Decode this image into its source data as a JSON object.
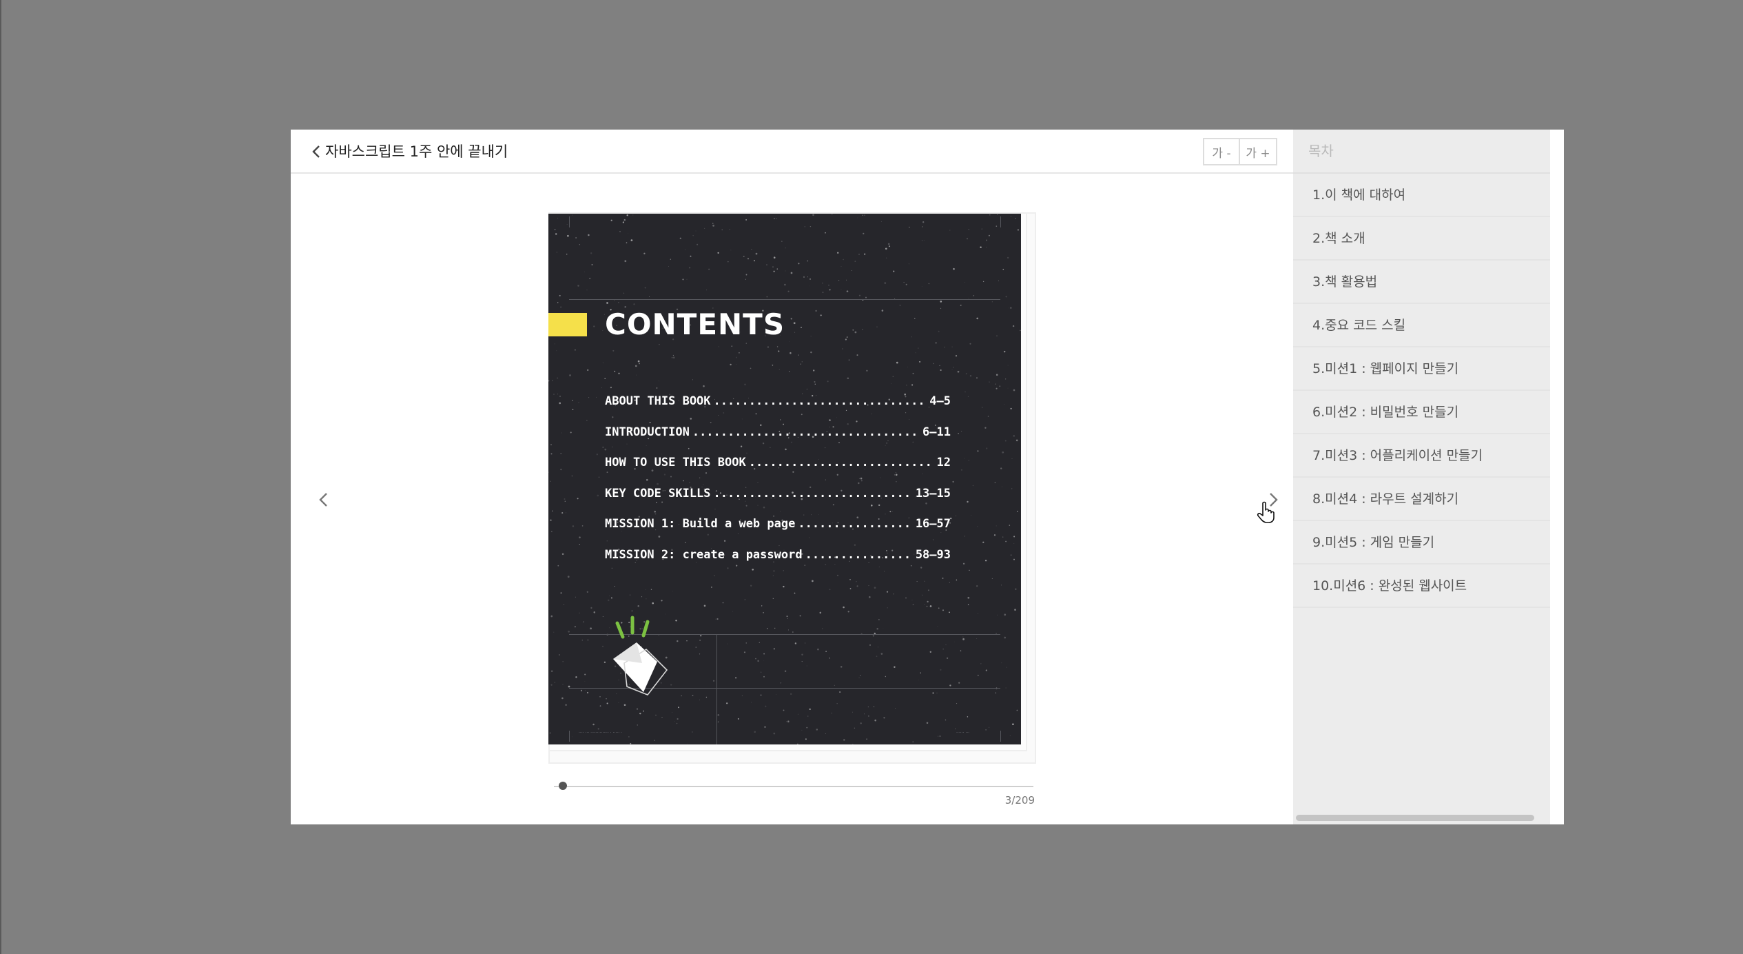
{
  "reader": {
    "title": "자바스크립트 1주 안에 끝내기",
    "font_decrease_label": "가 -",
    "font_increase_label": "가 +",
    "page_indicator": "3/209",
    "current_page": 3,
    "total_pages": 209
  },
  "book_page": {
    "heading": "CONTENTS",
    "entries": [
      {
        "label": "ABOUT THIS BOOK",
        "pages": "4–5"
      },
      {
        "label": "INTRODUCTION",
        "pages": "6–11"
      },
      {
        "label": "HOW TO USE THIS BOOK",
        "pages": "12"
      },
      {
        "label": "KEY CODE SKILLS",
        "pages": "13–15"
      },
      {
        "label": "MISSION 1: Build a web page",
        "pages": "16–57"
      },
      {
        "label": "MISSION 2: create a password",
        "pages": "58–93"
      }
    ],
    "accent_color": "#f5e04a",
    "background_color": "#26262b",
    "spark_color": "#7cc142"
  },
  "toc_panel": {
    "title": "목차",
    "items": [
      "1.이 책에 대하여",
      "2.책 소개",
      "3.책 활용법",
      "4.중요 코드 스킬",
      "5.미션1 : 웹페이지 만들기",
      "6.미션2 : 비밀번호 만들기",
      "7.미션3 : 어플리케이션 만들기",
      "8.미션4 : 라우트 설계하기",
      "9.미션5 : 게임 만들기",
      "10.미션6 : 완성된 웹사이트"
    ]
  },
  "icons": {
    "back": "chevron-left-icon",
    "prev": "chevron-left-icon",
    "next": "chevron-right-icon",
    "cursor": "hand-pointer-icon"
  }
}
